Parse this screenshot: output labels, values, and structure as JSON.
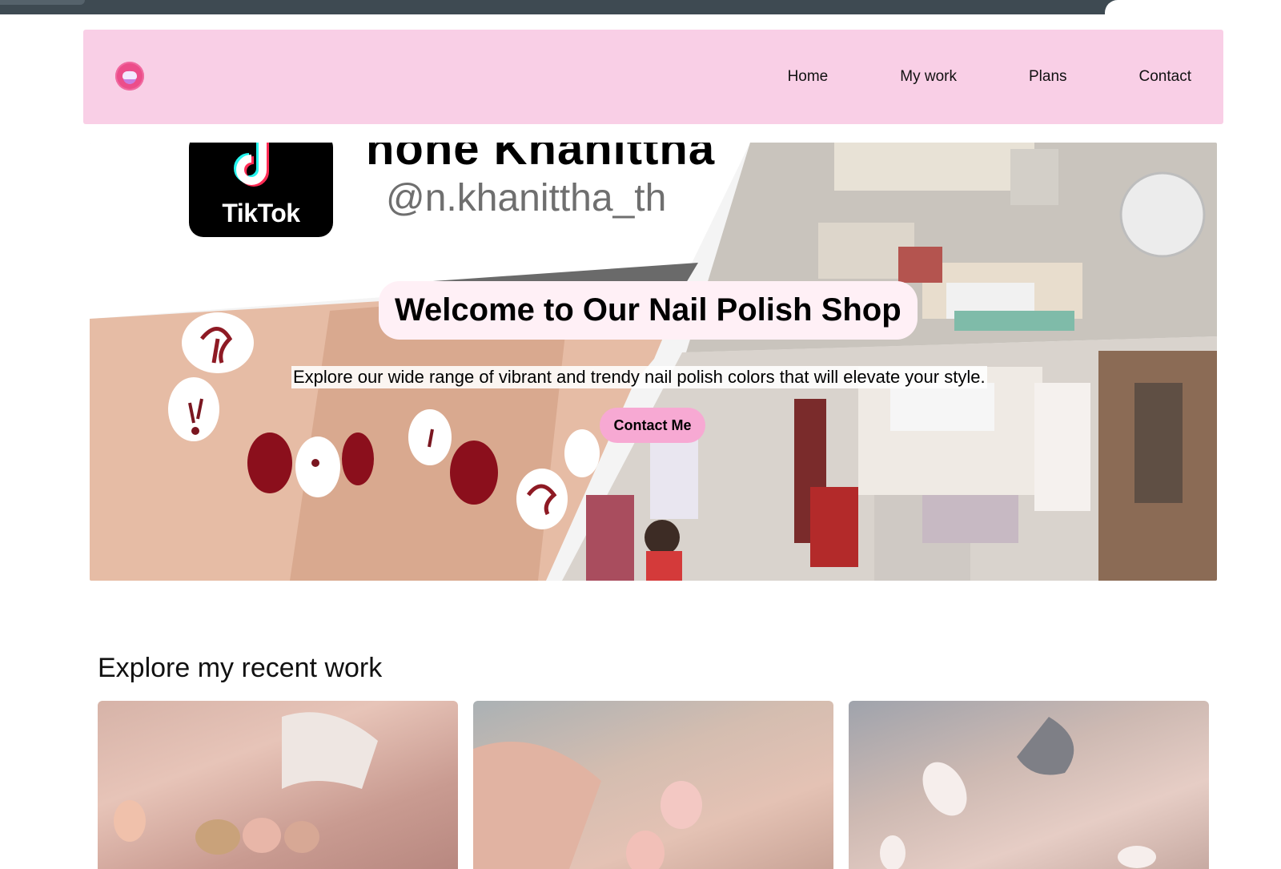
{
  "header": {
    "logo_icon": "shop-logo-icon",
    "nav": [
      {
        "label": "Home"
      },
      {
        "label": "My work"
      },
      {
        "label": "Plans"
      },
      {
        "label": "Contact"
      }
    ]
  },
  "hero": {
    "tiktok_word": "TikTok",
    "handle_partial": "none Khanittha",
    "handle": "@n.khanittha_th",
    "title": "Welcome to Our Nail Polish Shop",
    "subtitle": "Explore our wide range of vibrant and trendy nail polish colors that will elevate your style.",
    "cta_label": "Contact Me"
  },
  "recent_work": {
    "title": "Explore my recent work"
  },
  "colors": {
    "header_bg": "#f9cfe6",
    "cta_bg": "#f7a9d3",
    "title_pill_bg": "#fff0f6"
  }
}
